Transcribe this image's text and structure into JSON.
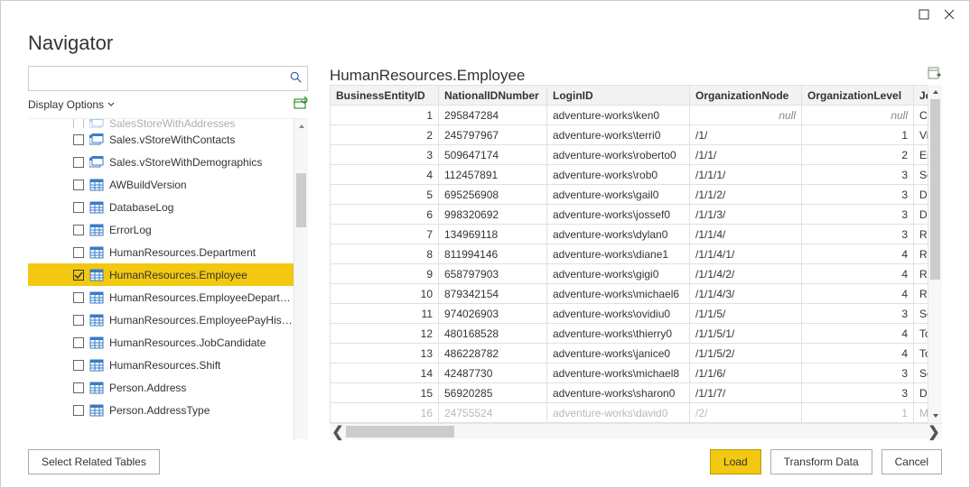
{
  "window": {
    "title": "Navigator",
    "maximize": "□",
    "close": "✕"
  },
  "search": {
    "value": "",
    "placeholder": ""
  },
  "displayOptions": "Display Options",
  "tree": {
    "items": [
      {
        "label": "SalesStoreWithAddresses",
        "checked": false,
        "iconType": "view",
        "cut": true
      },
      {
        "label": "Sales.vStoreWithContacts",
        "checked": false,
        "iconType": "view"
      },
      {
        "label": "Sales.vStoreWithDemographics",
        "checked": false,
        "iconType": "view"
      },
      {
        "label": "AWBuildVersion",
        "checked": false,
        "iconType": "table"
      },
      {
        "label": "DatabaseLog",
        "checked": false,
        "iconType": "table"
      },
      {
        "label": "ErrorLog",
        "checked": false,
        "iconType": "table"
      },
      {
        "label": "HumanResources.Department",
        "checked": false,
        "iconType": "table"
      },
      {
        "label": "HumanResources.Employee",
        "checked": true,
        "iconType": "table",
        "selected": true
      },
      {
        "label": "HumanResources.EmployeeDepartmen...",
        "checked": false,
        "iconType": "table"
      },
      {
        "label": "HumanResources.EmployeePayHistory",
        "checked": false,
        "iconType": "table"
      },
      {
        "label": "HumanResources.JobCandidate",
        "checked": false,
        "iconType": "table"
      },
      {
        "label": "HumanResources.Shift",
        "checked": false,
        "iconType": "table"
      },
      {
        "label": "Person.Address",
        "checked": false,
        "iconType": "table"
      },
      {
        "label": "Person.AddressType",
        "checked": false,
        "iconType": "table"
      }
    ]
  },
  "preview": {
    "title": "HumanResources.Employee",
    "columns": [
      "BusinessEntityID",
      "NationalIDNumber",
      "LoginID",
      "OrganizationNode",
      "OrganizationLevel",
      "JobTitle"
    ],
    "rows": [
      {
        "c1": "1",
        "c2": "295847284",
        "c3": "adventure-works\\ken0",
        "c4": null,
        "c5": null,
        "c6": "Chie"
      },
      {
        "c1": "2",
        "c2": "245797967",
        "c3": "adventure-works\\terri0",
        "c4": "/1/",
        "c5": "1",
        "c6": "Vice"
      },
      {
        "c1": "3",
        "c2": "509647174",
        "c3": "adventure-works\\roberto0",
        "c4": "/1/1/",
        "c5": "2",
        "c6": "Eng"
      },
      {
        "c1": "4",
        "c2": "112457891",
        "c3": "adventure-works\\rob0",
        "c4": "/1/1/1/",
        "c5": "3",
        "c6": "Sen"
      },
      {
        "c1": "5",
        "c2": "695256908",
        "c3": "adventure-works\\gail0",
        "c4": "/1/1/2/",
        "c5": "3",
        "c6": "Des"
      },
      {
        "c1": "6",
        "c2": "998320692",
        "c3": "adventure-works\\jossef0",
        "c4": "/1/1/3/",
        "c5": "3",
        "c6": "Des"
      },
      {
        "c1": "7",
        "c2": "134969118",
        "c3": "adventure-works\\dylan0",
        "c4": "/1/1/4/",
        "c5": "3",
        "c6": "Res"
      },
      {
        "c1": "8",
        "c2": "811994146",
        "c3": "adventure-works\\diane1",
        "c4": "/1/1/4/1/",
        "c5": "4",
        "c6": "Res"
      },
      {
        "c1": "9",
        "c2": "658797903",
        "c3": "adventure-works\\gigi0",
        "c4": "/1/1/4/2/",
        "c5": "4",
        "c6": "Res"
      },
      {
        "c1": "10",
        "c2": "879342154",
        "c3": "adventure-works\\michael6",
        "c4": "/1/1/4/3/",
        "c5": "4",
        "c6": "Res"
      },
      {
        "c1": "11",
        "c2": "974026903",
        "c3": "adventure-works\\ovidiu0",
        "c4": "/1/1/5/",
        "c5": "3",
        "c6": "Sen"
      },
      {
        "c1": "12",
        "c2": "480168528",
        "c3": "adventure-works\\thierry0",
        "c4": "/1/1/5/1/",
        "c5": "4",
        "c6": "Too"
      },
      {
        "c1": "13",
        "c2": "486228782",
        "c3": "adventure-works\\janice0",
        "c4": "/1/1/5/2/",
        "c5": "4",
        "c6": "Too"
      },
      {
        "c1": "14",
        "c2": "42487730",
        "c3": "adventure-works\\michael8",
        "c4": "/1/1/6/",
        "c5": "3",
        "c6": "Sen"
      },
      {
        "c1": "15",
        "c2": "56920285",
        "c3": "adventure-works\\sharon0",
        "c4": "/1/1/7/",
        "c5": "3",
        "c6": "Des"
      },
      {
        "c1": "16",
        "c2": "24755524",
        "c3": "adventure-works\\david0",
        "c4": "/2/",
        "c5": "1",
        "c6": "Ma"
      }
    ]
  },
  "footer": {
    "selectRelated": "Select Related Tables",
    "load": "Load",
    "transform": "Transform Data",
    "cancel": "Cancel"
  }
}
